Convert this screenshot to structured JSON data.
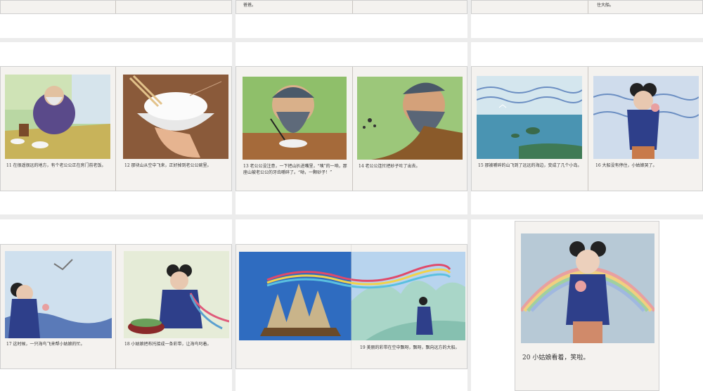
{
  "top_strip": {
    "caption_a": "爸爸。",
    "caption_b": "住大船。"
  },
  "pages": {
    "p11": {
      "caption": "11  在很遥很远的地方，有个老公公正在房门前老饭。"
    },
    "p12": {
      "caption": "12  那块山从空中飞来，正好掉到老公公碗里。"
    },
    "p13": {
      "caption": "13  老公公没注意，一下把山扒进嘴里，“咦”的一响，那座山被老公公的牙齿嚼碎了。“呦，一颗砂子！”"
    },
    "p14": {
      "caption": "14  老公公连忙把砂子吐了出去。"
    },
    "p15": {
      "caption": "15  那被嚼碎的山飞到了远远的海边，变成了几个小岛。"
    },
    "p16": {
      "caption": "16  大船没有停住，小姑娘哭了。"
    },
    "p17": {
      "caption": "17  这时候，一只海鸟飞来帮小姑娘的忙。"
    },
    "p18": {
      "caption": "18  小姑娘把布托接成一条彩带，让海鸟叼着。"
    },
    "p19": {
      "caption": "19  美丽的彩带在空中飘呀，飘呀，飘向远方的大船。"
    },
    "p20": {
      "caption": "20  小姑娘看着，笑啦。"
    }
  },
  "colors": {
    "page_bg": "#ececec",
    "tile_bg": "#ffffff",
    "book_page": "#f4f2ef",
    "sea_blue": "#3a66b8",
    "rainbow": "#e8a0a0"
  }
}
